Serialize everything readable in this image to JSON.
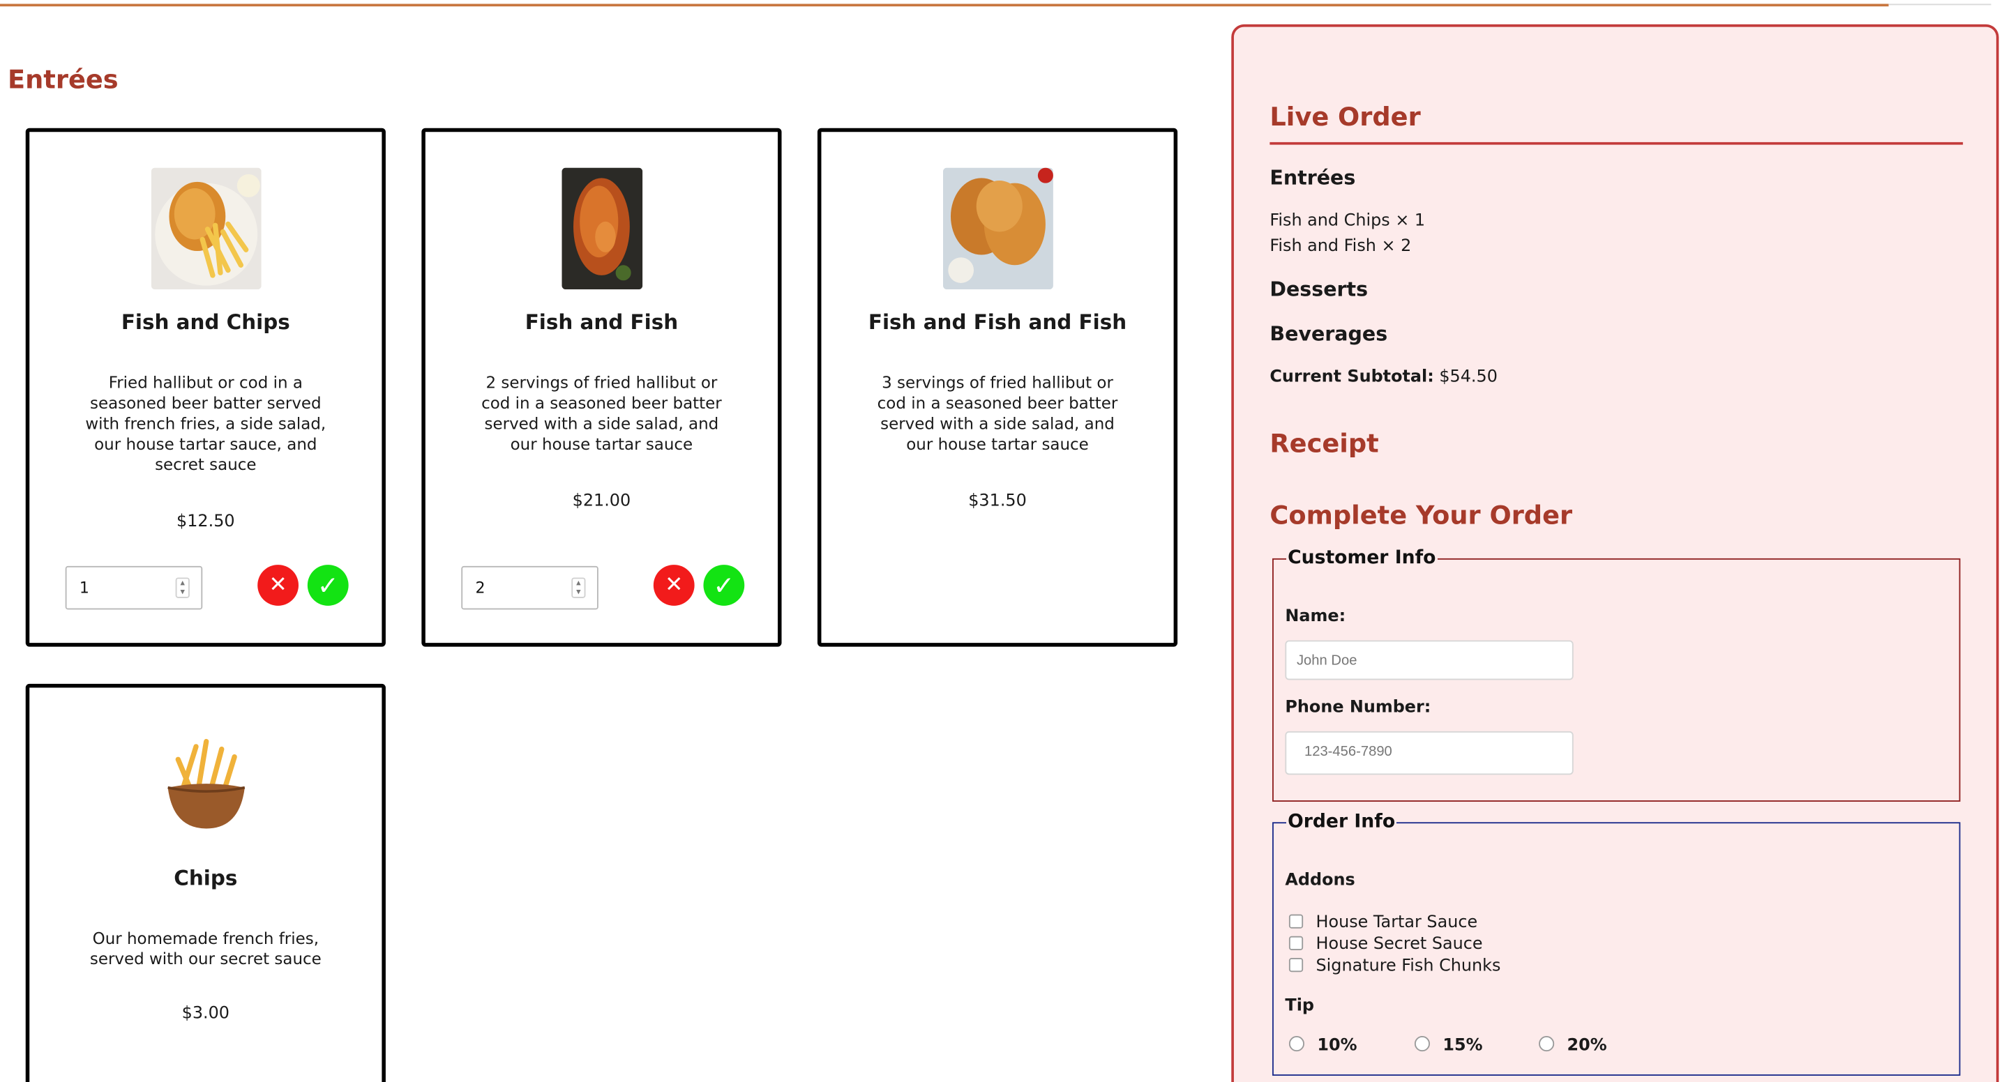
{
  "menu": {
    "section_title": "Entrées",
    "items": [
      {
        "name": "Fish and Chips",
        "description": "Fried hallibut or cod in a seasoned beer batter served with french fries, a side salad, our house tartar sauce, and secret sauce",
        "price": "$12.50",
        "quantity": "1",
        "selected": true,
        "image_icon": "fish-and-chips-photo"
      },
      {
        "name": "Fish and Fish",
        "description": "2 servings of fried hallibut or cod in a seasoned beer batter served with a side salad, and our house tartar sauce",
        "price": "$21.00",
        "quantity": "2",
        "selected": true,
        "image_icon": "fried-fish-photo"
      },
      {
        "name": "Fish and Fish and Fish",
        "description": "3 servings of fried hallibut or cod in a seasoned beer batter served with a side salad, and our house tartar sauce",
        "price": "$31.50",
        "quantity": null,
        "selected": false,
        "image_icon": "fried-fish-platter-photo"
      },
      {
        "name": "Chips",
        "description": "Our homemade french fries, served with our secret sauce",
        "price": "$3.00",
        "quantity": null,
        "selected": false,
        "image_icon": "fries-bowl-photo"
      }
    ],
    "remove_icon": "✕",
    "confirm_icon": "✓"
  },
  "live_order": {
    "title": "Live Order",
    "categories": [
      {
        "name": "Entrées",
        "lines": [
          "Fish and Chips × 1",
          "Fish and Fish × 2"
        ]
      },
      {
        "name": "Desserts",
        "lines": []
      },
      {
        "name": "Beverages",
        "lines": []
      }
    ],
    "subtotal_label": "Current Subtotal:",
    "subtotal_value": "$54.50"
  },
  "receipt": {
    "title": "Receipt"
  },
  "checkout": {
    "title": "Complete Your Order",
    "customer_info": {
      "legend": "Customer Info",
      "name_label": "Name:",
      "name_placeholder": "John Doe",
      "phone_label": "Phone Number:",
      "phone_placeholder": "123-456-7890"
    },
    "order_info": {
      "legend": "Order Info",
      "addons_label": "Addons",
      "addons": [
        "House Tartar Sauce",
        "House Secret Sauce",
        "Signature Fish Chunks"
      ],
      "tip_label": "Tip",
      "tips": [
        "10%",
        "15%",
        "20%"
      ]
    }
  },
  "colors": {
    "accent": "#a63a2a",
    "panel_bg": "#fdebeb",
    "panel_border": "#c33b3b",
    "order_info_border": "#1a2a8a",
    "remove": "#f21b1b",
    "confirm": "#13e313"
  }
}
